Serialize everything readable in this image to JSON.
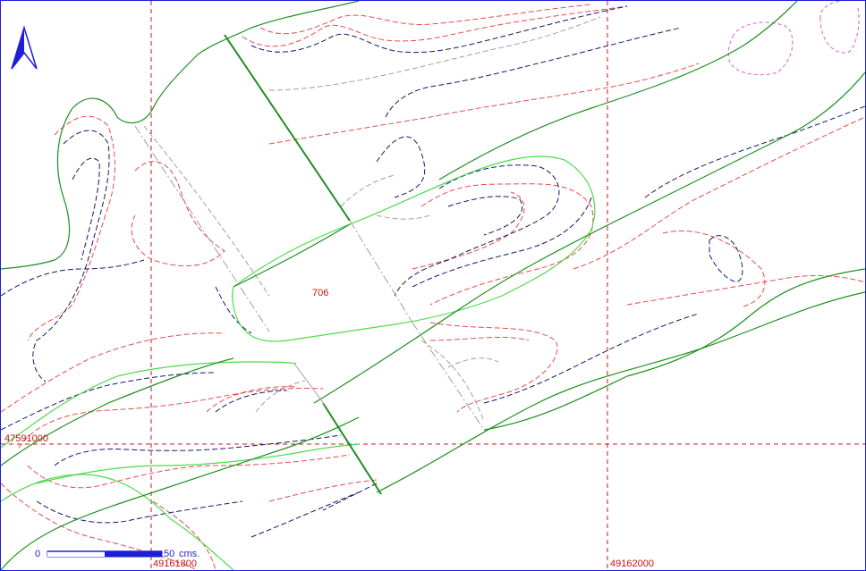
{
  "map": {
    "grid": {
      "northing_label": "47591000",
      "easting_labels": [
        "49161800",
        "49162000"
      ]
    },
    "parcel_label": "706",
    "scale": {
      "start_label": "0",
      "end_label": "50",
      "unit_label": "cms."
    },
    "north_arrow": "north-arrow-icon",
    "colors": {
      "border": "#1e1ed8",
      "grid_line": "#c81414",
      "contour_red": "#e84a4a",
      "contour_navy": "#17176e",
      "contour_gray": "#a0a0a0",
      "contour_magenta": "#d060d0",
      "boundary_dark": "#1f8f1f",
      "boundary_light": "#4ddb4d"
    }
  }
}
